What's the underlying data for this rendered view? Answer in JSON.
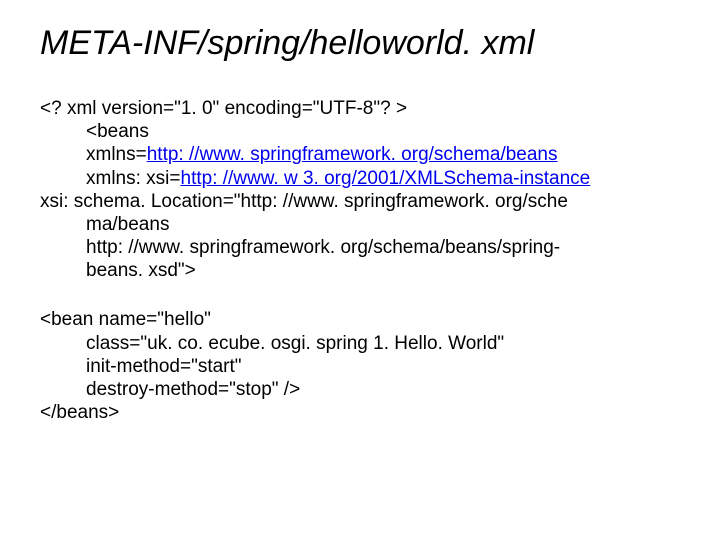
{
  "title": "META-INF/spring/helloworld. xml",
  "lines": {
    "l1": "<? xml version=\"1. 0\" encoding=\"UTF-8\"? >",
    "l2": "<beans",
    "l3a": "xmlns=",
    "l3b": "http: //www. springframework. org/schema/beans",
    "l4a": "xmlns: xsi=",
    "l4b": "http: //www. w 3. org/2001/XMLSchema-instance",
    "l5": "xsi: schema. Location=\"http: //www. springframework. org/sche",
    "l6": "ma/beans",
    "l7": "http: //www. springframework. org/schema/beans/spring-",
    "l8": "beans. xsd\">",
    "b1": "<bean name=\"hello\"",
    "b2": "class=\"uk. co. ecube. osgi. spring 1. Hello. World\"",
    "b3": "init-method=\"start\"",
    "b4": "destroy-method=\"stop\" />",
    "b5": "</beans>"
  }
}
